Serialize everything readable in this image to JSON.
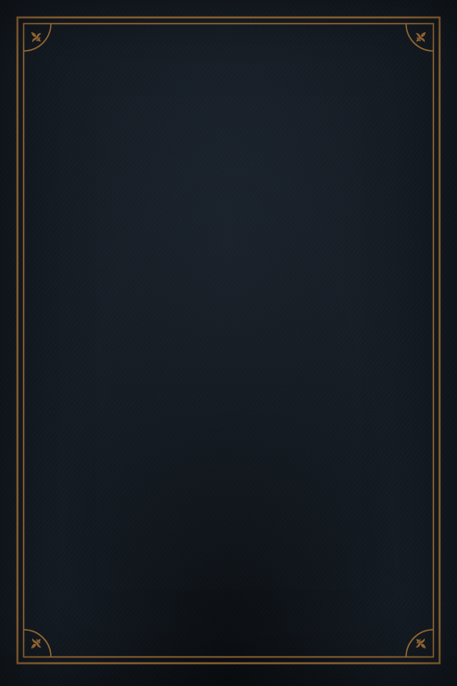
{
  "cover": {
    "background_color": "#131a22",
    "ornament_color": "#b07a3c",
    "border_style": "double-line",
    "corner_ornament": "fleur-de-lis-icon"
  }
}
